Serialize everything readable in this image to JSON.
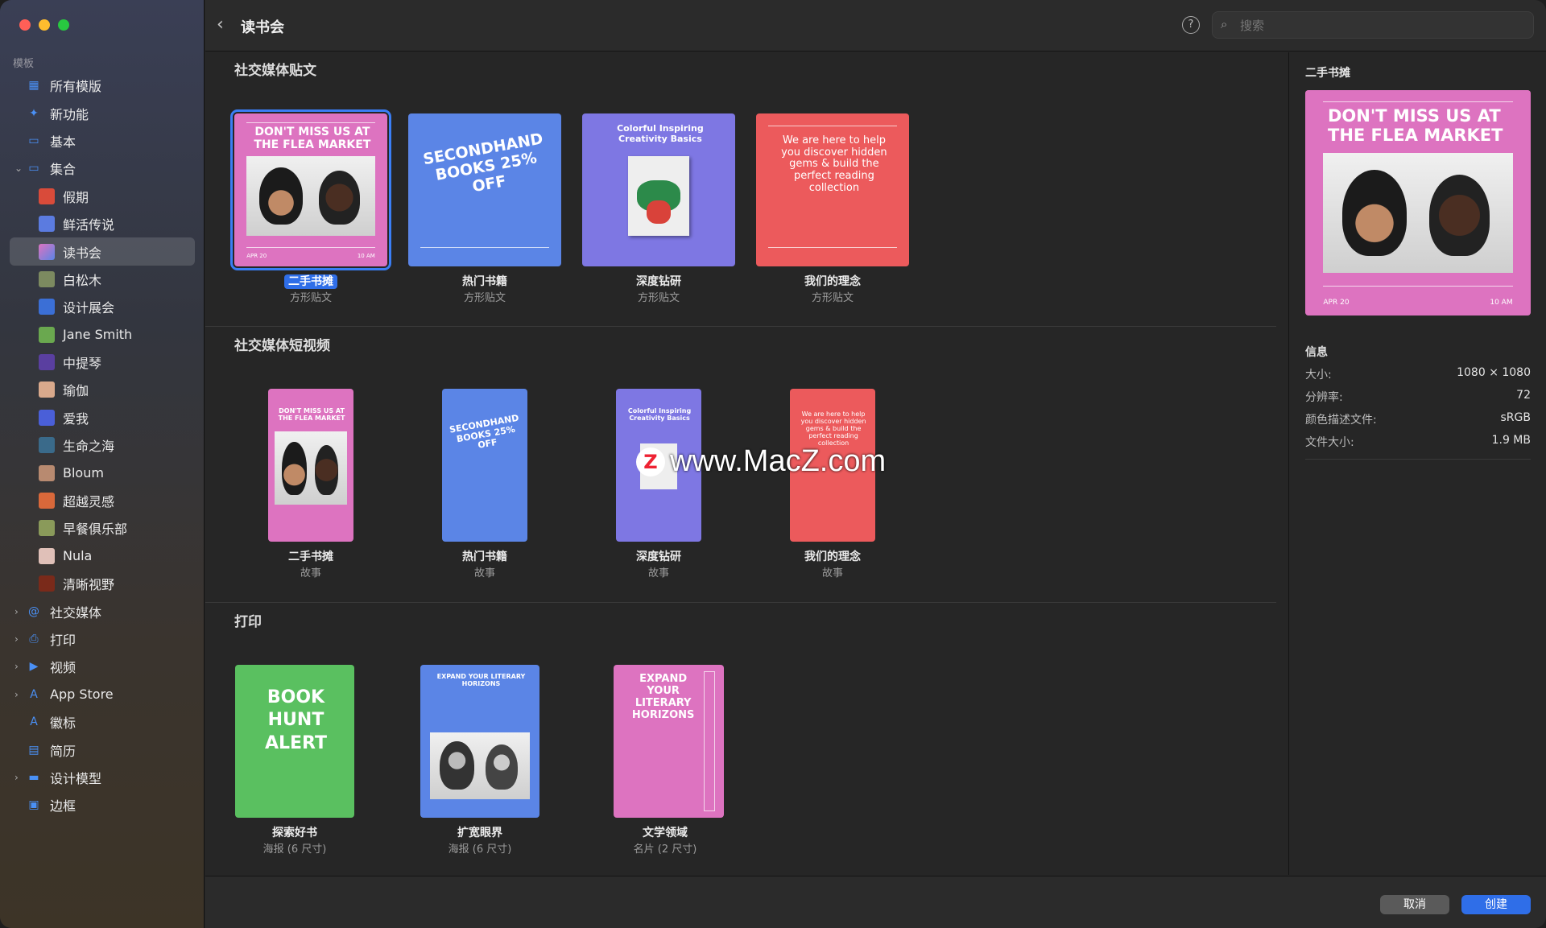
{
  "sidebar": {
    "section": "模板",
    "items": [
      {
        "label": "所有模版",
        "icon": "grid-icon"
      },
      {
        "label": "新功能",
        "icon": "sparkle-icon"
      },
      {
        "label": "基本",
        "icon": "rectangle-icon"
      },
      {
        "label": "集合",
        "icon": "collection-icon",
        "expanded": true
      },
      {
        "label": "假期"
      },
      {
        "label": "鲜活传说"
      },
      {
        "label": "读书会",
        "selected": true
      },
      {
        "label": "白松木"
      },
      {
        "label": "设计展会"
      },
      {
        "label": "Jane Smith"
      },
      {
        "label": "中提琴"
      },
      {
        "label": "瑜伽"
      },
      {
        "label": "爱我"
      },
      {
        "label": "生命之海"
      },
      {
        "label": "Bloum"
      },
      {
        "label": "超越灵感"
      },
      {
        "label": "早餐俱乐部"
      },
      {
        "label": "Nula"
      },
      {
        "label": "清晰视野"
      },
      {
        "label": "社交媒体",
        "icon": "at-icon"
      },
      {
        "label": "打印",
        "icon": "printer-icon"
      },
      {
        "label": "视频",
        "icon": "play-icon"
      },
      {
        "label": "App Store",
        "icon": "appstore-icon"
      },
      {
        "label": "徽标",
        "icon": "letter-a-icon"
      },
      {
        "label": "简历",
        "icon": "document-icon"
      },
      {
        "label": "设计模型",
        "icon": "monitor-icon"
      },
      {
        "label": "边框",
        "icon": "photo-frame-icon"
      }
    ]
  },
  "topbar": {
    "title": "读书会",
    "search_placeholder": "搜索"
  },
  "sections": [
    {
      "title": "社交媒体贴文",
      "tiles": [
        {
          "name": "二手书摊",
          "sub": "方形贴文",
          "head": "DON'T MISS US AT THE FLEA MARKET",
          "style": "pink",
          "selected": true
        },
        {
          "name": "热门书籍",
          "sub": "方形贴文",
          "head": "SECONDHAND BOOKS 25% OFF",
          "style": "blue"
        },
        {
          "name": "深度钻研",
          "sub": "方形贴文",
          "head": "Colorful Inspiring Creativity Basics",
          "style": "purple"
        },
        {
          "name": "我们的理念",
          "sub": "方形贴文",
          "head": "We are here to help you discover hidden gems & build the perfect reading collection",
          "style": "red"
        }
      ]
    },
    {
      "title": "社交媒体短视频",
      "tiles": [
        {
          "name": "二手书摊",
          "sub": "故事",
          "head": "DON'T MISS US AT THE FLEA MARKET",
          "style": "pink"
        },
        {
          "name": "热门书籍",
          "sub": "故事",
          "head": "SECONDHAND BOOKS 25% OFF",
          "style": "blue"
        },
        {
          "name": "深度钻研",
          "sub": "故事",
          "head": "Colorful Inspiring Creativity Basics",
          "style": "purple"
        },
        {
          "name": "我们的理念",
          "sub": "故事",
          "head": "We are here to help you discover hidden gems & build the perfect reading collection",
          "style": "red"
        }
      ]
    },
    {
      "title": "打印",
      "tiles": [
        {
          "name": "探索好书",
          "sub": "海报 (6 尺寸)",
          "head": "BOOK HUNT ALERT",
          "style": "green"
        },
        {
          "name": "扩宽眼界",
          "sub": "海报 (6 尺寸)",
          "head": "EXPAND YOUR LITERARY HORIZONS",
          "style": "blue"
        },
        {
          "name": "文学领域",
          "sub": "名片 (2 尺寸)",
          "head": "EXPAND YOUR LITERARY HORIZONS",
          "style": "pink"
        }
      ]
    }
  ],
  "panel": {
    "title": "二手书摊",
    "preview_head": "DON'T MISS US AT THE FLEA MARKET",
    "preview_foot_left": "APR 20",
    "preview_foot_right": "10 AM",
    "info_title": "信息",
    "info": [
      {
        "key": "大小:",
        "value": "1080 × 1080"
      },
      {
        "key": "分辨率:",
        "value": "72"
      },
      {
        "key": "颜色描述文件:",
        "value": "sRGB"
      },
      {
        "key": "文件大小:",
        "value": "1.9 MB"
      }
    ]
  },
  "buttons": {
    "cancel": "取消",
    "create": "创建"
  },
  "watermark": "www.MacZ.com",
  "colors": {
    "accent": "#2f6ee8",
    "pink": "#dd73c0",
    "blue": "#5b85e6",
    "purple": "#7e77e3",
    "red": "#ec5a5c",
    "green": "#5ac060"
  }
}
